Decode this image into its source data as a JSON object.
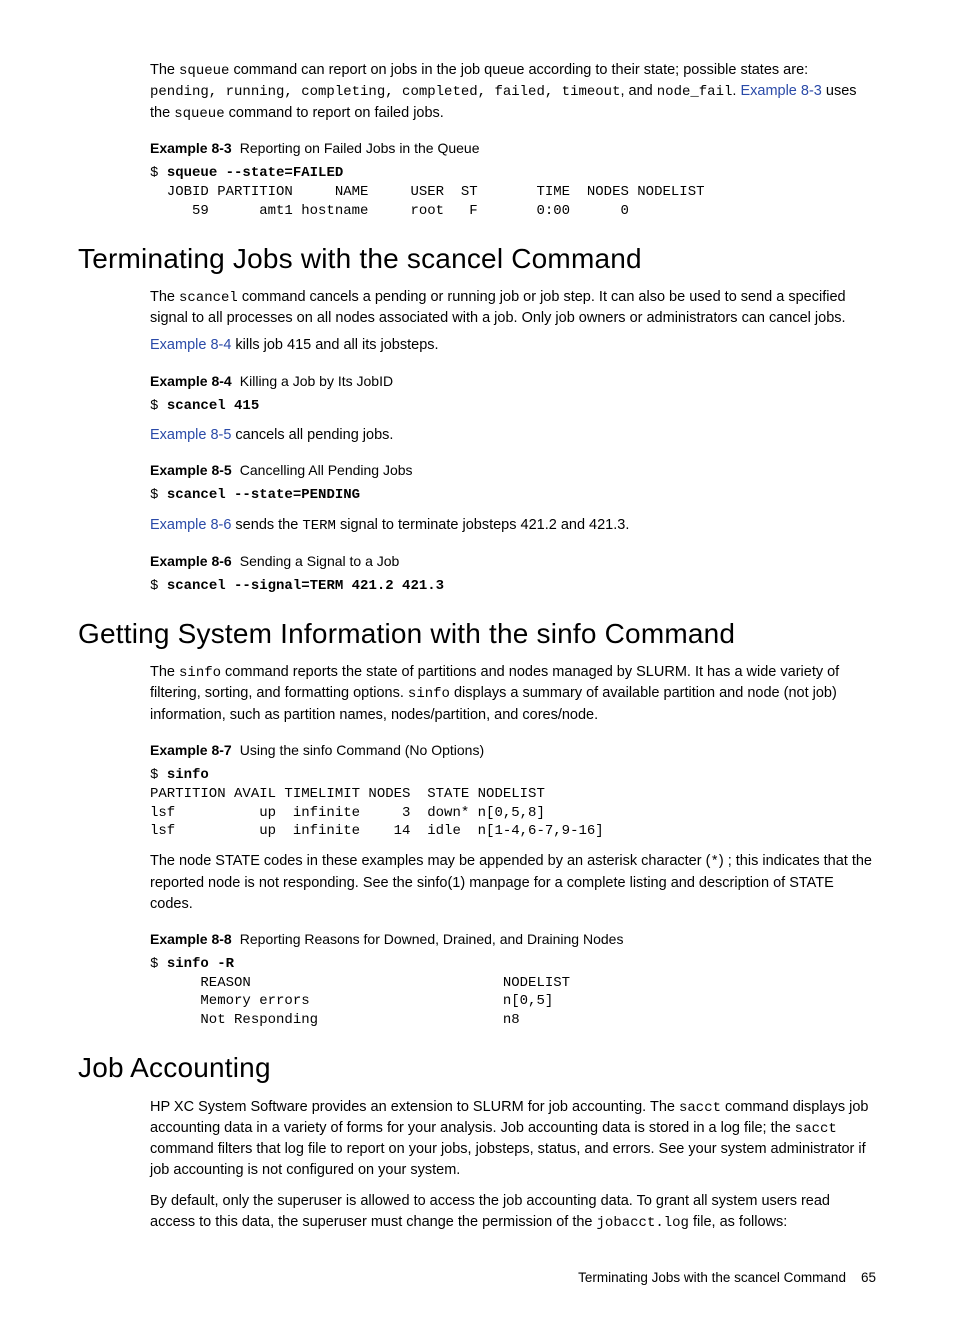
{
  "intro": {
    "p1_a": "The ",
    "p1_cmd1": "squeue",
    "p1_b": " command can report on jobs in the job queue according to their state; possible states are: ",
    "p1_states": "pending, running, completing, completed, failed, timeout",
    "p1_c": ", and ",
    "p1_state_last": "node_fail",
    "p1_d": ". ",
    "p1_link": "Example  8-3",
    "p1_e": " uses the ",
    "p1_cmd2": "squeue",
    "p1_f": " command to report on failed jobs."
  },
  "ex83": {
    "label": "Example  8-3",
    "caption": "Reporting on Failed Jobs in the Queue",
    "prompt": "$ ",
    "cmd": "squeue --state=FAILED",
    "out": "  JOBID PARTITION     NAME     USER  ST       TIME  NODES NODELIST\n     59      amt1 hostname     root   F       0:00      0"
  },
  "h1": "Terminating Jobs with the scancel Command",
  "scancel": {
    "p1_a": "The ",
    "p1_cmd": "scancel",
    "p1_b": " command cancels a pending or running job or job step. It can also be used to send a specified signal to all processes on all nodes associated with a job. Only job owners or administrators can cancel jobs.",
    "p2_link": "Example  8-4",
    "p2_rest": " kills job 415 and all its jobsteps."
  },
  "ex84": {
    "label": "Example  8-4",
    "caption": "Killing a Job by Its JobID",
    "prompt": "$ ",
    "cmd": "scancel 415"
  },
  "p85": {
    "link": "Example  8-5",
    "rest": " cancels all pending jobs."
  },
  "ex85": {
    "label": "Example  8-5",
    "caption": "Cancelling All Pending Jobs",
    "prompt": "$ ",
    "cmd": "scancel --state=PENDING"
  },
  "p86": {
    "link": "Example  8-6",
    "a": " sends the ",
    "sig": "TERM",
    "b": " signal to terminate jobsteps 421.2 and 421.3."
  },
  "ex86": {
    "label": "Example  8-6",
    "caption": "Sending a Signal to a Job",
    "prompt": "$ ",
    "cmd": "scancel --signal=TERM 421.2 421.3"
  },
  "h2": "Getting System Information with the sinfo Command",
  "sinfo": {
    "p1_a": "The ",
    "p1_cmd1": "sinfo",
    "p1_b": " command reports the state of partitions and nodes managed by SLURM. It has a wide variety of filtering, sorting, and formatting options. ",
    "p1_cmd2": "sinfo",
    "p1_c": " displays a summary of available partition and node (not job) information, such as partition names, nodes/partition, and cores/node."
  },
  "ex87": {
    "label": "Example  8-7",
    "caption": "Using the sinfo Command (No Options)",
    "prompt": "$ ",
    "cmd": "sinfo",
    "out": "PARTITION AVAIL TIMELIMIT NODES  STATE NODELIST\nlsf          up  infinite     3  down* n[0,5,8]\nlsf          up  infinite    14  idle  n[1-4,6-7,9-16]"
  },
  "sinfo_note": {
    "a": "The node STATE codes in these examples may be appended by an asterisk character (",
    "star": "*",
    "b": ") ; this indicates that the reported node is not responding. See the sinfo(1) manpage for a complete listing and description of STATE codes."
  },
  "ex88": {
    "label": "Example  8-8",
    "caption": "Reporting Reasons for Downed, Drained, and Draining Nodes",
    "prompt": "$ ",
    "cmd": "sinfo -R",
    "out": "      REASON                              NODELIST\n      Memory errors                       n[0,5]\n      Not Responding                      n8"
  },
  "h3": "Job Accounting",
  "jobacct": {
    "p1_a": "HP XC System Software provides an extension to SLURM for job accounting. The ",
    "p1_cmd1": "sacct",
    "p1_b": " command displays job accounting data in a variety of forms for your analysis. Job accounting data is stored in a log file; the ",
    "p1_cmd2": "sacct",
    "p1_c": " command filters that log file to report on your jobs, jobsteps, status, and errors. See your system administrator if job accounting is not configured on your system.",
    "p2_a": "By default, only the superuser is allowed to access the job accounting data. To grant all system users read access to this data, the superuser must change the permission of the ",
    "p2_file": "jobacct.log",
    "p2_b": " file, as follows:"
  },
  "footer": {
    "title": "Terminating Jobs with the scancel Command",
    "page": "65"
  }
}
